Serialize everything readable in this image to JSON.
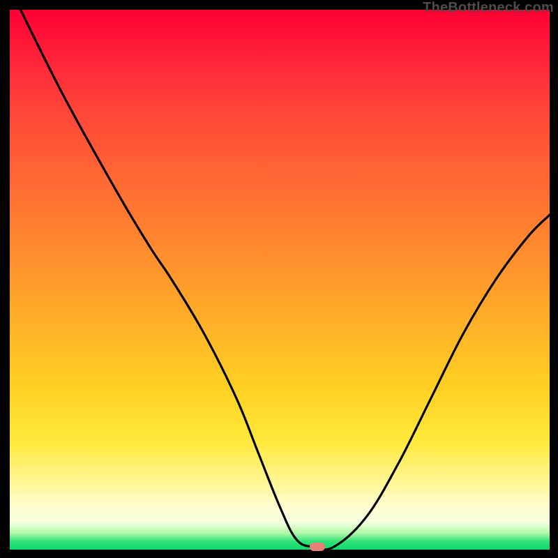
{
  "attribution": "TheBottleneck.com",
  "chart_data": {
    "type": "line",
    "title": "",
    "xlabel": "",
    "ylabel": "",
    "xlim": [
      0,
      100
    ],
    "ylim": [
      0,
      100
    ],
    "grid": false,
    "legend": false,
    "series": [
      {
        "name": "bottleneck-curve",
        "x": [
          2,
          10,
          20,
          26,
          30,
          36,
          42,
          46,
          50,
          53,
          56,
          60,
          66,
          72,
          78,
          84,
          90,
          96,
          100
        ],
        "values": [
          100,
          84,
          66,
          56,
          50,
          40,
          28,
          18,
          8,
          2,
          0.5,
          0.5,
          6,
          16,
          28,
          40,
          50,
          58,
          62
        ]
      }
    ],
    "marker": {
      "x": 57,
      "y": 0.5
    },
    "gradient_stops": [
      {
        "pos": 0,
        "color": "#ff0033"
      },
      {
        "pos": 45,
        "color": "#ff8c2d"
      },
      {
        "pos": 80,
        "color": "#ffe93c"
      },
      {
        "pos": 97,
        "color": "#acf7a4"
      },
      {
        "pos": 100,
        "color": "#0ed96f"
      }
    ]
  }
}
